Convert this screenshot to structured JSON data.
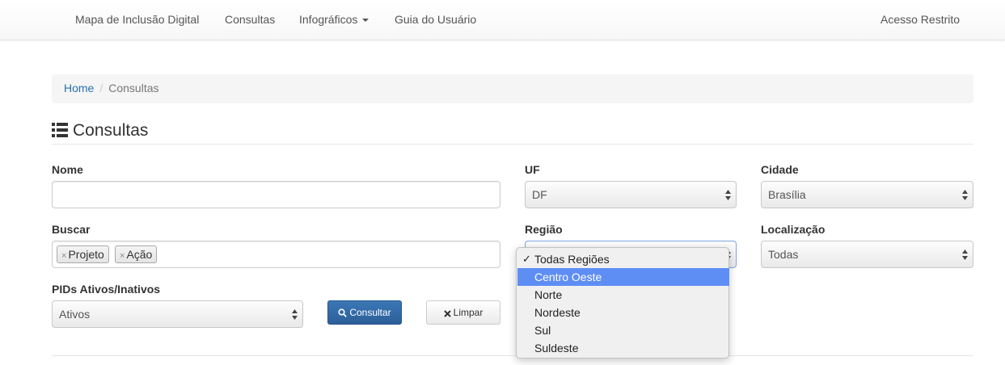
{
  "navbar": {
    "items": [
      {
        "label": "Mapa de Inclusão Digital"
      },
      {
        "label": "Consultas"
      },
      {
        "label": "Infográficos"
      },
      {
        "label": "Guia do Usuário"
      }
    ],
    "restricted_label": "Acesso Restrito"
  },
  "breadcrumb": {
    "home": "Home",
    "current": "Consultas"
  },
  "page": {
    "title": "Consultas"
  },
  "form": {
    "nome": {
      "label": "Nome",
      "value": ""
    },
    "uf": {
      "label": "UF",
      "value": "DF"
    },
    "cidade": {
      "label": "Cidade",
      "value": "Brasília"
    },
    "buscar": {
      "label": "Buscar",
      "tags": [
        "Projeto",
        "Ação"
      ]
    },
    "regiao": {
      "label": "Região",
      "value": "Todas Regiões",
      "options": [
        "Todas Regiões",
        "Centro Oeste",
        "Norte",
        "Nordeste",
        "Sul",
        "Suldeste"
      ],
      "checked_index": 0,
      "highlighted_index": 1
    },
    "localizacao": {
      "label": "Localização",
      "value": "Todas"
    },
    "pids": {
      "label": "PIDs Ativos/Inativos",
      "value": "Ativos"
    }
  },
  "buttons": {
    "consultar": "Consultar",
    "limpar": "Limpar"
  },
  "icons": {
    "title": "list-icon",
    "consultar": "search-icon",
    "limpar": "times-icon",
    "tag_remove": "×",
    "check": "✓"
  },
  "colors": {
    "link": "#2a6fb0",
    "primary_button": "#3071a9",
    "dropdown_highlight": "#5e8ef4"
  }
}
